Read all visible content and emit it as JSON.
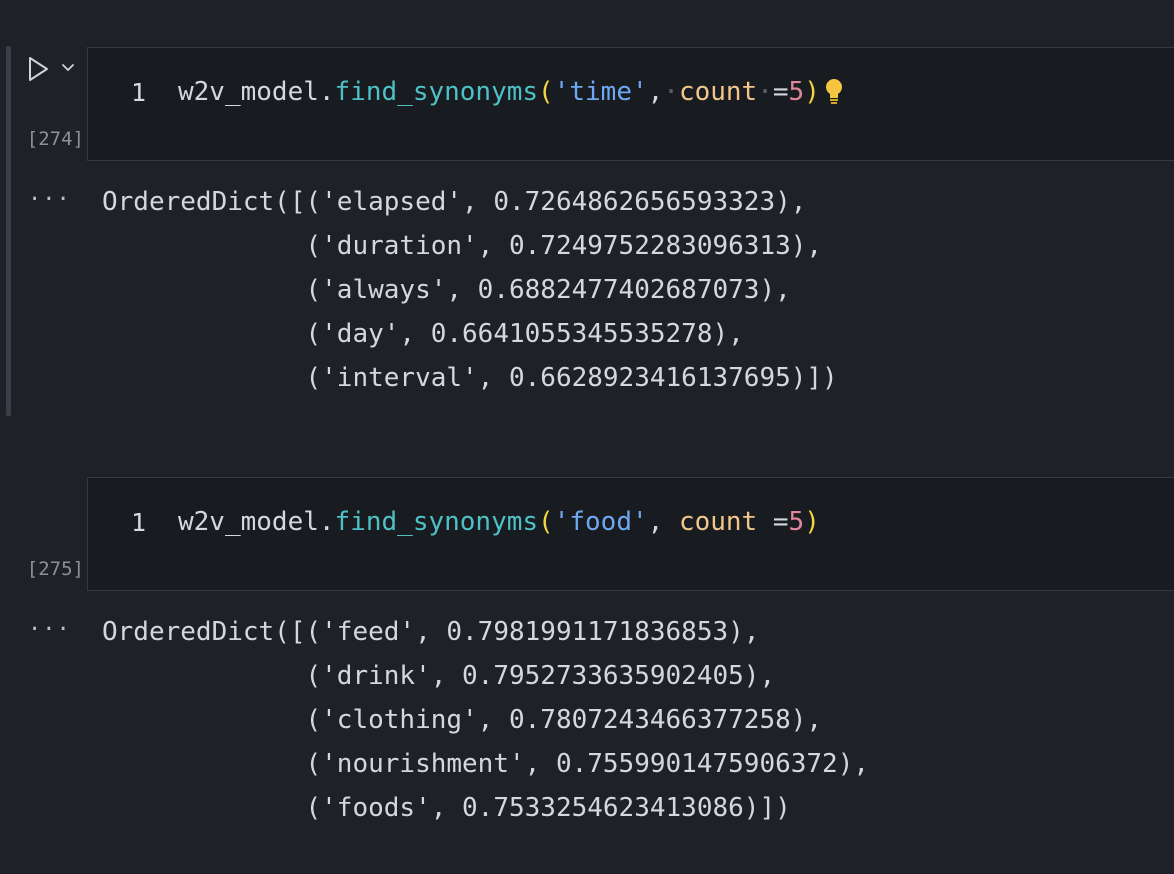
{
  "cells": [
    {
      "exec_count": "[274]",
      "line_number": "1",
      "code": {
        "obj": "w2v_model",
        "dot": ".",
        "func": "find_synonyms",
        "open": "(",
        "arg": "'time'",
        "comma": ",",
        "param": "count",
        "eq": "=",
        "num": "5",
        "close": ")"
      },
      "output": "OrderedDict([('elapsed', 0.7264862656593323),\n             ('duration', 0.7249752283096313),\n             ('always', 0.6882477402687073),\n             ('day', 0.6641055345535278),\n             ('interval', 0.6628923416137695)])"
    },
    {
      "exec_count": "[275]",
      "line_number": "1",
      "code": {
        "obj": "w2v_model",
        "dot": ".",
        "func": "find_synonyms",
        "open": "(",
        "arg": "'food'",
        "comma": ",",
        "param": "count",
        "eq": "=",
        "num": "5",
        "close": ")"
      },
      "output": "OrderedDict([('feed', 0.7981991171836853),\n             ('drink', 0.7952733635902405),\n             ('clothing', 0.7807243466377258),\n             ('nourishment', 0.7559901475906372),\n             ('foods', 0.7533254623413086)])"
    }
  ],
  "icons": {
    "run": "play-icon",
    "run_options": "chevron-down-icon",
    "hint": "lightbulb-icon",
    "output_actions": "ellipsis-icon",
    "output_more_label": "···"
  },
  "colors": {
    "background": "#1e2228",
    "editor": "#181b20",
    "function": "#4ec1c6",
    "string": "#6ea8f2",
    "parameter": "#f2c58a",
    "number": "#e0879c",
    "bracket": "#f5d442"
  }
}
